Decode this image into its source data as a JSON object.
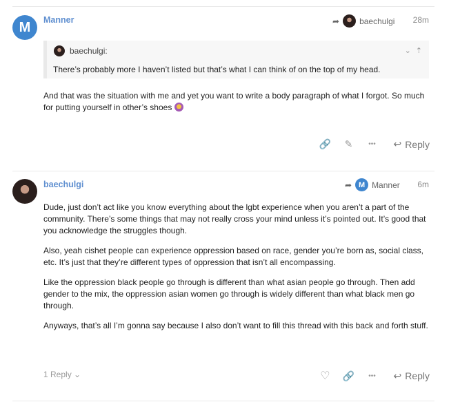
{
  "posts": [
    {
      "avatar_letter": "M",
      "username": "Manner",
      "reply_to_user": "baechulgi",
      "time": "28m",
      "quote": {
        "author": "baechulgi:",
        "text": "There’s probably more I haven’t listed but that’s what I can think of on the top of my head."
      },
      "paragraphs": [
        "And that was the situation with me and yet you want to write a body paragraph of what I forgot. So much for putting yourself in other’s shoes"
      ],
      "emoji": "woman-facepalming-emoji",
      "reply_label": "Reply"
    },
    {
      "username": "baechulgi",
      "reply_to_user": "Manner",
      "reply_to_avatar_letter": "M",
      "time": "6m",
      "paragraphs": [
        "Dude, just don’t act like you know everything about the lgbt experience when you aren’t a part of the community. There’s some things that may not really cross your mind unless it’s pointed out. It’s good that you acknowledge the struggles though.",
        "Also, yeah cishet people can experience oppression based on race, gender you’re born as, social class, etc. It’s just that they’re different types of oppression that isn’t all encompassing.",
        "Like the oppression black people go through is different than what asian people go through. Then add gender to the mix, the oppression asian women go through is widely different than what black men go through.",
        "Anyways, that’s all I’m gonna say because I also don’t want to fill this thread with this back and forth stuff."
      ],
      "replies_label": "1 Reply",
      "reply_label": "Reply"
    }
  ],
  "icons": {
    "share": "🔗",
    "edit": "✎",
    "more": "•••",
    "like": "♡",
    "reply": "↩",
    "chevron_down": "⌄",
    "jump_up": "⇡"
  },
  "colors": {
    "username": "#5f8fd0",
    "avatar_m": "#3f86cf"
  }
}
